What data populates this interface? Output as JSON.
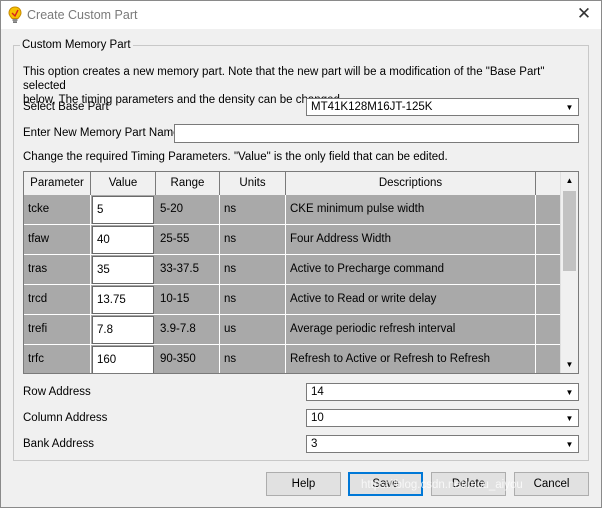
{
  "window": {
    "title": "Create Custom Part"
  },
  "group": {
    "legend": "Custom Memory Part",
    "info_line1": "This option creates a new memory part. Note that the new part will be a modification of the \"Base Part\" selected",
    "info_line2": "below. The timing parameters and the density can be changed."
  },
  "base_part": {
    "label": "Select Base Part",
    "value": "MT41K128M16JT-125K"
  },
  "new_name": {
    "label": "Enter New Memory Part Name",
    "value": ""
  },
  "timing_note": "Change the required Timing Parameters. \"Value\" is the only field that can be edited.",
  "table": {
    "headers": [
      "Parameter",
      "Value",
      "Range",
      "Units",
      "Descriptions"
    ],
    "rows": [
      {
        "parameter": "tcke",
        "value": "5",
        "range": "5-20",
        "units": "ns",
        "description": "CKE minimum pulse width"
      },
      {
        "parameter": "tfaw",
        "value": "40",
        "range": "25-55",
        "units": "ns",
        "description": "Four Address Width"
      },
      {
        "parameter": "tras",
        "value": "35",
        "range": "33-37.5",
        "units": "ns",
        "description": "Active to Precharge command"
      },
      {
        "parameter": "trcd",
        "value": "13.75",
        "range": "10-15",
        "units": "ns",
        "description": "Active to Read or write delay"
      },
      {
        "parameter": "trefi",
        "value": "7.8",
        "range": "3.9-7.8",
        "units": "us",
        "description": "Average periodic refresh interval"
      },
      {
        "parameter": "trfc",
        "value": "160",
        "range": "90-350",
        "units": "ns",
        "description": "Refresh to Active or Refresh to Refresh"
      }
    ]
  },
  "row_address": {
    "label": "Row Address",
    "value": "14"
  },
  "column_address": {
    "label": "Column Address",
    "value": "10"
  },
  "bank_address": {
    "label": "Bank Address",
    "value": "3"
  },
  "buttons": {
    "help": "Help",
    "save": "Save",
    "delete": "Delete",
    "cancel": "Cancel"
  },
  "watermark": "https://blog.csdn.net/mcu_aiyou",
  "icons": {
    "app": "lightbulb-icon",
    "close": "close-icon",
    "dropdown": "chevron-down-icon"
  },
  "colors": {
    "row_bg": "#a9a9a9",
    "default_border": "#0078d7"
  }
}
